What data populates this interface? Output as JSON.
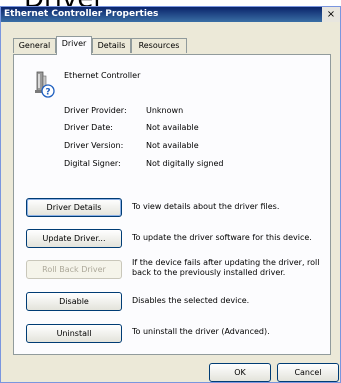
{
  "banner": {
    "text": "Driver"
  },
  "window": {
    "title": "Ethernet Controller Properties",
    "close_symbol": "×"
  },
  "tabs": [
    {
      "label": "General"
    },
    {
      "label": "Driver"
    },
    {
      "label": "Details"
    },
    {
      "label": "Resources"
    }
  ],
  "device": {
    "name": "Ethernet Controller",
    "icon": "network-adapter-warning-icon"
  },
  "info": [
    {
      "label": "Driver Provider:",
      "value": "Unknown"
    },
    {
      "label": "Driver Date:",
      "value": "Not available"
    },
    {
      "label": "Driver Version:",
      "value": "Not available"
    },
    {
      "label": "Digital Signer:",
      "value": "Not digitally signed"
    }
  ],
  "actions": [
    {
      "label": "Driver Details",
      "description": "To view details about the driver files."
    },
    {
      "label": "Update Driver...",
      "description": "To update the driver software for this device."
    },
    {
      "label": "Roll Back Driver",
      "description": "If the device fails after updating the driver, roll back to the previously installed driver."
    },
    {
      "label": "Disable",
      "description": "Disables the selected device."
    },
    {
      "label": "Uninstall",
      "description": "To uninstall the driver (Advanced)."
    }
  ],
  "footer": {
    "ok_label": "OK",
    "cancel_label": "Cancel"
  },
  "colors": {
    "titlebar": "#0a246a",
    "dialog_bg": "#ece9d8",
    "panel_bg": "#fcfcfe"
  }
}
